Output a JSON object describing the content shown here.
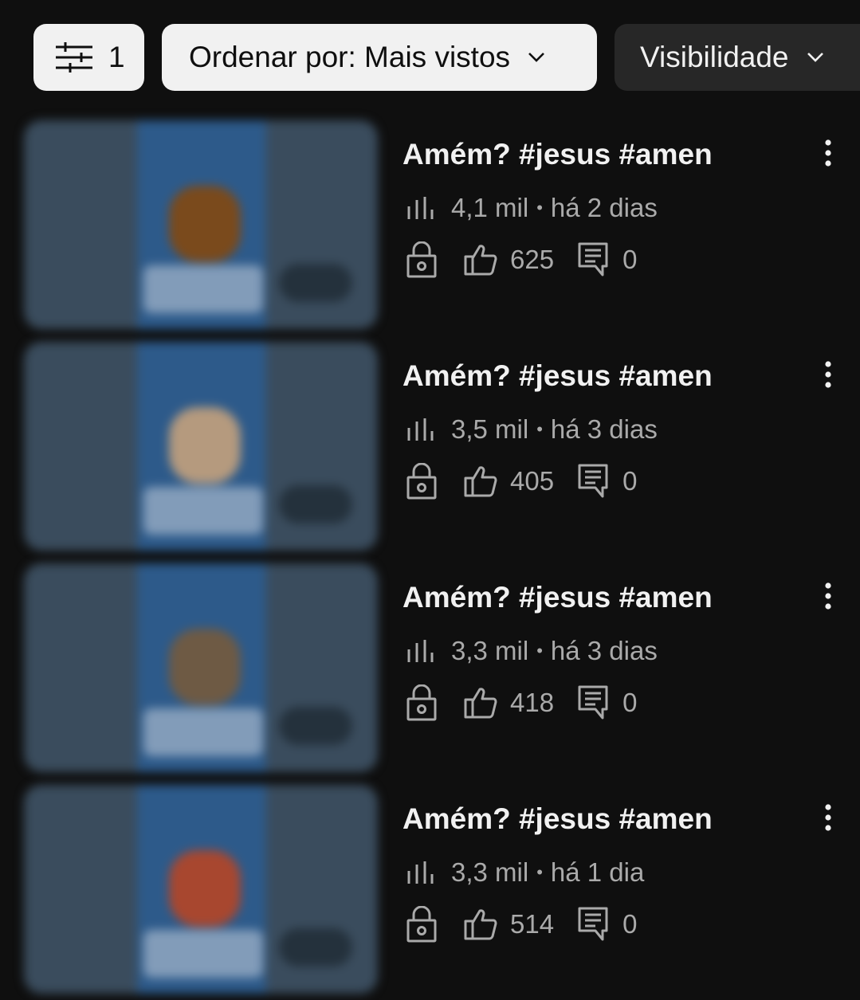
{
  "filters": {
    "filter_count": "1",
    "sort_label": "Ordenar por: Mais vistos",
    "visibility_label": "Visibilidade"
  },
  "videos": [
    {
      "title": "Amém? #jesus #amen",
      "views": "4,1 mil",
      "separator": "•",
      "age": "há 2 dias",
      "likes": "625",
      "comments": "0",
      "thumb_accent": "#7a4a1c"
    },
    {
      "title": "Amém? #jesus #amen",
      "views": "3,5 mil",
      "separator": "•",
      "age": "há 3 dias",
      "likes": "405",
      "comments": "0",
      "thumb_accent": "#b59a7e"
    },
    {
      "title": "Amém? #jesus #amen",
      "views": "3,3 mil",
      "separator": "•",
      "age": "há 3 dias",
      "likes": "418",
      "comments": "0",
      "thumb_accent": "#6e5a44"
    },
    {
      "title": "Amém? #jesus #amen",
      "views": "3,3 mil",
      "separator": "•",
      "age": "há 1 dia",
      "likes": "514",
      "comments": "0",
      "thumb_accent": "#a8472f"
    }
  ],
  "icons": {
    "filter": "sliders-icon",
    "chevron": "chevron-down-icon",
    "views": "bar-chart-icon",
    "visibility": "lock-icon",
    "likes": "thumb-up-icon",
    "comments": "comment-icon",
    "menu": "more-vert-icon"
  },
  "colors": {
    "background": "#0f0f0f",
    "chip_light": "#f1f1f1",
    "chip_dark": "#272727",
    "secondary_text": "#aaaaaa"
  }
}
